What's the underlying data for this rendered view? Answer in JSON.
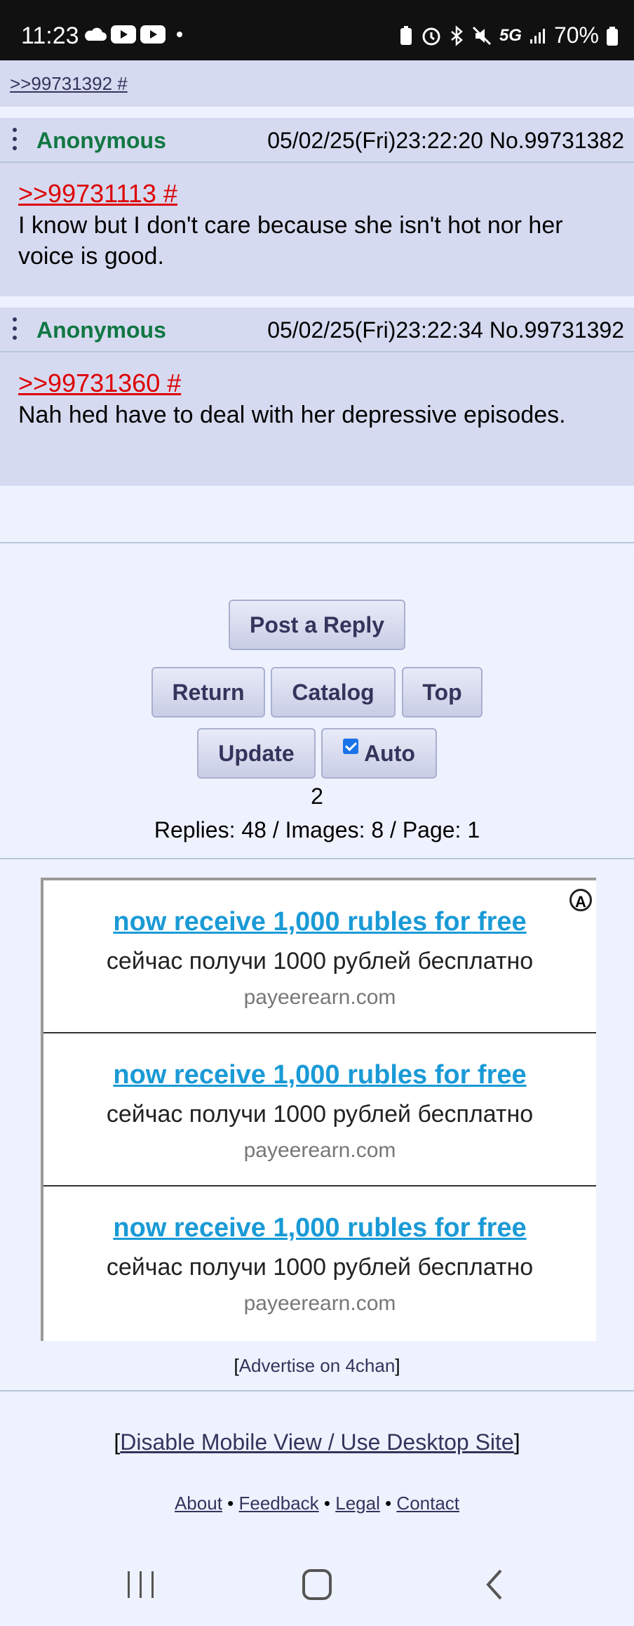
{
  "status_bar": {
    "time": "11:23",
    "battery": "70%",
    "network": "5G"
  },
  "top_link": ">>99731392 #",
  "posts": [
    {
      "name": "Anonymous",
      "date": "05/02/25(Fri)23:22:20",
      "no": "No.99731382",
      "quote": ">>99731113 #",
      "text": "I know but I don't care because she isn't hot nor her voice is good."
    },
    {
      "name": "Anonymous",
      "date": "05/02/25(Fri)23:22:34",
      "no": "No.99731392",
      "quote": ">>99731360 #",
      "text": "Nah hed have to deal with her depressive episodes."
    }
  ],
  "buttons": {
    "post_reply": "Post a Reply",
    "return": "Return",
    "catalog": "Catalog",
    "top": "Top",
    "update": "Update",
    "auto": "Auto"
  },
  "auto_checked": true,
  "update_count": "2",
  "thread_stats": "Replies: 48 / Images: 8 / Page: 1",
  "ads": [
    {
      "title": "now receive 1,000 rubles for free",
      "desc": "сейчас получи 1000 рублей бесплатно",
      "url": "payeerearn.com"
    },
    {
      "title": "now receive 1,000 rubles for free",
      "desc": "сейчас получи 1000 рублей бесплатно",
      "url": "payeerearn.com"
    },
    {
      "title": "now receive 1,000 rubles for free",
      "desc": "сейчас получи 1000 рублей бесплатно",
      "url": "payeerearn.com"
    }
  ],
  "advertise_link": "Advertise on 4chan",
  "desktop_link": "Disable Mobile View / Use Desktop Site",
  "footer_links": [
    "About",
    "Feedback",
    "Legal",
    "Contact"
  ],
  "colors": {
    "name_green": "#117743",
    "quote_red": "#dd0000",
    "post_bg": "#d6daf0",
    "page_bg": "#eef2ff",
    "ad_link": "#1a9ad6"
  }
}
